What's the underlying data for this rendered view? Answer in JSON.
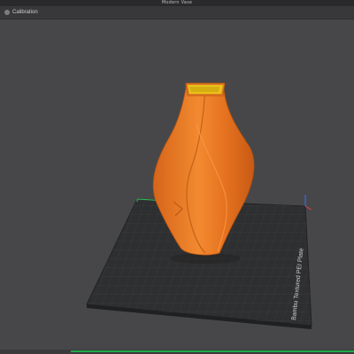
{
  "window": {
    "title": "Modern Vase"
  },
  "toolbar": {
    "tab_label": "Calibration",
    "tab_icon": "calibration-icon"
  },
  "viewport": {
    "plate_label": "Bambu Textured PEI Plate",
    "model_color": "#f07d24",
    "opening_color": "#e8c21a",
    "plate_color": "#2e2f31"
  },
  "progress": {
    "value": 0.8,
    "color": "#1faa4a"
  }
}
